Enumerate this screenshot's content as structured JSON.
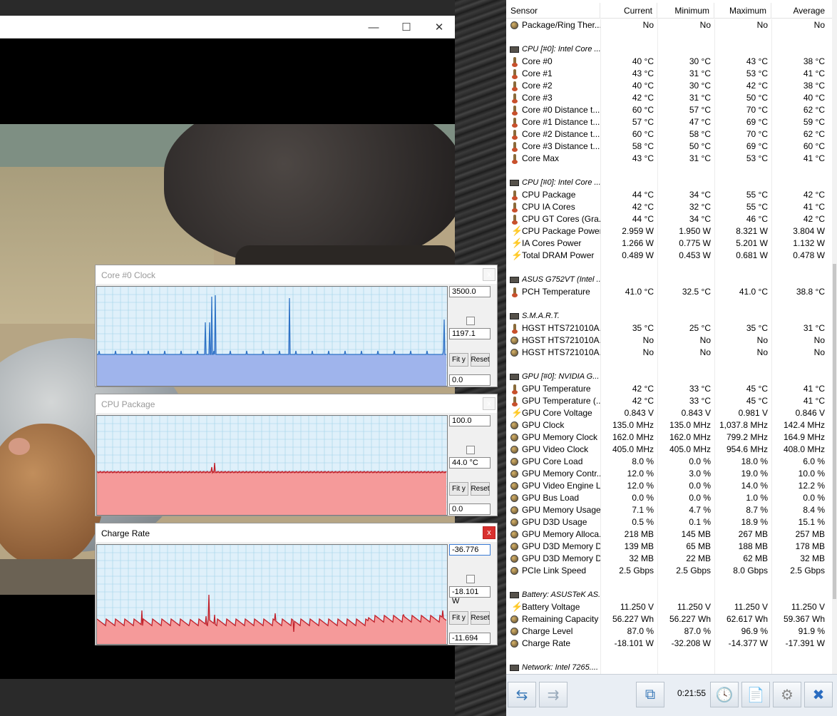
{
  "player": {
    "minimize": "—",
    "maximize": "☐",
    "close": "✕"
  },
  "graphs": [
    {
      "title": "Core #0 Clock",
      "max": "3500.0",
      "current": "1197.1",
      "min": "0.0",
      "fit": "Fit y",
      "reset": "Reset",
      "active": false,
      "fill": "#9fb4ec",
      "line": "#2f73c6",
      "close": "x",
      "data": [
        8,
        8,
        8,
        8,
        8,
        8,
        7,
        8,
        8,
        8,
        10,
        8,
        8,
        7,
        8,
        8,
        8,
        8,
        8,
        8,
        10,
        8,
        8,
        8,
        8,
        8,
        8,
        8,
        8,
        8,
        8,
        8,
        10,
        8,
        8,
        8,
        8,
        8,
        8,
        8,
        8,
        8,
        8,
        8,
        8,
        8,
        8,
        8,
        10,
        8,
        8,
        8,
        8,
        8,
        8,
        8,
        8,
        8,
        8,
        8,
        8,
        8,
        8,
        8,
        8,
        8,
        8,
        8,
        8,
        8,
        10,
        8,
        8,
        8,
        8,
        8,
        8,
        8,
        8,
        8,
        8,
        8,
        8,
        8,
        8,
        8,
        8,
        8,
        8,
        8,
        10,
        8,
        8,
        8,
        8,
        8,
        8,
        8,
        8,
        8,
        8,
        8,
        8,
        8,
        8,
        8,
        8,
        8,
        8,
        8,
        8,
        8,
        8,
        8,
        8,
        8,
        8,
        8,
        8,
        8,
        8,
        8,
        8,
        8,
        8,
        8,
        8,
        8,
        8,
        8,
        8,
        8,
        8,
        8,
        8,
        8,
        8,
        8,
        8,
        8,
        8,
        8,
        8,
        8,
        8,
        8,
        8,
        8,
        8,
        8,
        8,
        8,
        8,
        8,
        8,
        8,
        8,
        8,
        8,
        8,
        8,
        8,
        8,
        8,
        8,
        8,
        8,
        8,
        8,
        8,
        8,
        8,
        8,
        8,
        8,
        8,
        8,
        8,
        8,
        8,
        8,
        8,
        8,
        8,
        8,
        8,
        8,
        8,
        8,
        8,
        8,
        8,
        8,
        8,
        8,
        8,
        8,
        8,
        8,
        8,
        8,
        8,
        8,
        8,
        8,
        8,
        8,
        8,
        8,
        8,
        8,
        8,
        8,
        8,
        8,
        8,
        8,
        8,
        8,
        8,
        8,
        8,
        8,
        8,
        8,
        8,
        8,
        8,
        8,
        8,
        8,
        8,
        8,
        8,
        8,
        8,
        8,
        8,
        8,
        8,
        8,
        8,
        8,
        8,
        8,
        8,
        8,
        8,
        8,
        8,
        8,
        8,
        8,
        8,
        8,
        8
      ]
    },
    {
      "title": "CPU Package",
      "max": "100.0",
      "current": "44.0 °C",
      "min": "0.0",
      "fit": "Fit y",
      "reset": "Reset",
      "active": false,
      "fill": "#f59a9a",
      "line": "#c0202a",
      "close": "x",
      "data": []
    },
    {
      "title": "Charge Rate",
      "max": "-36.776",
      "current": "-18.101 W",
      "min": "-11.694",
      "fit": "Fit y",
      "reset": "Reset",
      "active": true,
      "fill": "#f59a9a",
      "line": "#c0202a",
      "close": "x",
      "data": []
    }
  ],
  "hwinfo": {
    "columns": [
      "Sensor",
      "Current",
      "Minimum",
      "Maximum",
      "Average"
    ],
    "rows": [
      {
        "t": "s",
        "i": "dot",
        "n": "Package/Ring Ther...",
        "v": [
          "No",
          "No",
          "No",
          "No"
        ]
      },
      {
        "t": "b"
      },
      {
        "t": "h",
        "i": "chip",
        "n": "CPU [#0]: Intel Core ..."
      },
      {
        "t": "s",
        "i": "therm",
        "n": "Core #0",
        "v": [
          "40 °C",
          "30 °C",
          "43 °C",
          "38 °C"
        ]
      },
      {
        "t": "s",
        "i": "therm",
        "n": "Core #1",
        "v": [
          "43 °C",
          "31 °C",
          "53 °C",
          "41 °C"
        ]
      },
      {
        "t": "s",
        "i": "therm",
        "n": "Core #2",
        "v": [
          "40 °C",
          "30 °C",
          "42 °C",
          "38 °C"
        ]
      },
      {
        "t": "s",
        "i": "therm",
        "n": "Core #3",
        "v": [
          "42 °C",
          "31 °C",
          "50 °C",
          "40 °C"
        ]
      },
      {
        "t": "s",
        "i": "therm",
        "n": "Core #0 Distance t...",
        "v": [
          "60 °C",
          "57 °C",
          "70 °C",
          "62 °C"
        ]
      },
      {
        "t": "s",
        "i": "therm",
        "n": "Core #1 Distance t...",
        "v": [
          "57 °C",
          "47 °C",
          "69 °C",
          "59 °C"
        ]
      },
      {
        "t": "s",
        "i": "therm",
        "n": "Core #2 Distance t...",
        "v": [
          "60 °C",
          "58 °C",
          "70 °C",
          "62 °C"
        ]
      },
      {
        "t": "s",
        "i": "therm",
        "n": "Core #3 Distance t...",
        "v": [
          "58 °C",
          "50 °C",
          "69 °C",
          "60 °C"
        ]
      },
      {
        "t": "s",
        "i": "therm",
        "n": "Core Max",
        "v": [
          "43 °C",
          "31 °C",
          "53 °C",
          "41 °C"
        ]
      },
      {
        "t": "b"
      },
      {
        "t": "h",
        "i": "chip",
        "n": "CPU [#0]: Intel Core ..."
      },
      {
        "t": "s",
        "i": "therm",
        "n": "CPU Package",
        "v": [
          "44 °C",
          "34 °C",
          "55 °C",
          "42 °C"
        ]
      },
      {
        "t": "s",
        "i": "therm",
        "n": "CPU IA Cores",
        "v": [
          "42 °C",
          "32 °C",
          "55 °C",
          "41 °C"
        ]
      },
      {
        "t": "s",
        "i": "therm",
        "n": "CPU GT Cores (Gra...",
        "v": [
          "44 °C",
          "34 °C",
          "46 °C",
          "42 °C"
        ]
      },
      {
        "t": "s",
        "i": "bolt",
        "n": "CPU Package Power",
        "v": [
          "2.959 W",
          "1.950 W",
          "8.321 W",
          "3.804 W"
        ]
      },
      {
        "t": "s",
        "i": "bolt",
        "n": "IA Cores Power",
        "v": [
          "1.266 W",
          "0.775 W",
          "5.201 W",
          "1.132 W"
        ]
      },
      {
        "t": "s",
        "i": "bolt",
        "n": "Total DRAM Power",
        "v": [
          "0.489 W",
          "0.453 W",
          "0.681 W",
          "0.478 W"
        ]
      },
      {
        "t": "b"
      },
      {
        "t": "h",
        "i": "chip",
        "n": "ASUS G752VT (Intel ..."
      },
      {
        "t": "s",
        "i": "therm",
        "n": "PCH Temperature",
        "v": [
          "41.0 °C",
          "32.5 °C",
          "41.0 °C",
          "38.8 °C"
        ]
      },
      {
        "t": "b"
      },
      {
        "t": "h",
        "i": "chip",
        "n": "S.M.A.R.T."
      },
      {
        "t": "s",
        "i": "therm",
        "n": "HGST HTS721010A...",
        "v": [
          "35 °C",
          "25 °C",
          "35 °C",
          "31 °C"
        ]
      },
      {
        "t": "s",
        "i": "dot",
        "n": "HGST HTS721010A...",
        "v": [
          "No",
          "No",
          "No",
          "No"
        ]
      },
      {
        "t": "s",
        "i": "dot",
        "n": "HGST HTS721010A...",
        "v": [
          "No",
          "No",
          "No",
          "No"
        ]
      },
      {
        "t": "b"
      },
      {
        "t": "h",
        "i": "chip",
        "n": "GPU [#0]: NVIDIA G..."
      },
      {
        "t": "s",
        "i": "therm",
        "n": "GPU Temperature",
        "v": [
          "42 °C",
          "33 °C",
          "45 °C",
          "41 °C"
        ]
      },
      {
        "t": "s",
        "i": "therm",
        "n": "GPU Temperature (...",
        "v": [
          "42 °C",
          "33 °C",
          "45 °C",
          "41 °C"
        ]
      },
      {
        "t": "s",
        "i": "bolt",
        "n": "GPU Core Voltage",
        "v": [
          "0.843 V",
          "0.843 V",
          "0.981 V",
          "0.846 V"
        ]
      },
      {
        "t": "s",
        "i": "dot",
        "n": "GPU Clock",
        "v": [
          "135.0 MHz",
          "135.0 MHz",
          "1,037.8 MHz",
          "142.4 MHz"
        ]
      },
      {
        "t": "s",
        "i": "dot",
        "n": "GPU Memory Clock",
        "v": [
          "162.0 MHz",
          "162.0 MHz",
          "799.2 MHz",
          "164.9 MHz"
        ]
      },
      {
        "t": "s",
        "i": "dot",
        "n": "GPU Video Clock",
        "v": [
          "405.0 MHz",
          "405.0 MHz",
          "954.6 MHz",
          "408.0 MHz"
        ]
      },
      {
        "t": "s",
        "i": "dot",
        "n": "GPU Core Load",
        "v": [
          "8.0 %",
          "0.0 %",
          "18.0 %",
          "6.0 %"
        ]
      },
      {
        "t": "s",
        "i": "dot",
        "n": "GPU Memory Contr...",
        "v": [
          "12.0 %",
          "3.0 %",
          "19.0 %",
          "10.0 %"
        ]
      },
      {
        "t": "s",
        "i": "dot",
        "n": "GPU Video Engine L...",
        "v": [
          "12.0 %",
          "0.0 %",
          "14.0 %",
          "12.2 %"
        ]
      },
      {
        "t": "s",
        "i": "dot",
        "n": "GPU Bus Load",
        "v": [
          "0.0 %",
          "0.0 %",
          "1.0 %",
          "0.0 %"
        ]
      },
      {
        "t": "s",
        "i": "dot",
        "n": "GPU Memory Usage",
        "v": [
          "7.1 %",
          "4.7 %",
          "8.7 %",
          "8.4 %"
        ]
      },
      {
        "t": "s",
        "i": "dot",
        "n": "GPU D3D Usage",
        "v": [
          "0.5 %",
          "0.1 %",
          "18.9 %",
          "15.1 %"
        ]
      },
      {
        "t": "s",
        "i": "dot",
        "n": "GPU Memory Alloca...",
        "v": [
          "218 MB",
          "145 MB",
          "267 MB",
          "257 MB"
        ]
      },
      {
        "t": "s",
        "i": "dot",
        "n": "GPU D3D Memory D...",
        "v": [
          "139 MB",
          "65 MB",
          "188 MB",
          "178 MB"
        ]
      },
      {
        "t": "s",
        "i": "dot",
        "n": "GPU D3D Memory D...",
        "v": [
          "32 MB",
          "22 MB",
          "62 MB",
          "32 MB"
        ]
      },
      {
        "t": "s",
        "i": "dot",
        "n": "PCIe Link Speed",
        "v": [
          "2.5 Gbps",
          "2.5 Gbps",
          "8.0 Gbps",
          "2.5 Gbps"
        ]
      },
      {
        "t": "b"
      },
      {
        "t": "h",
        "i": "chip",
        "n": "Battery: ASUSTeK AS..."
      },
      {
        "t": "s",
        "i": "bolt",
        "n": "Battery Voltage",
        "v": [
          "11.250 V",
          "11.250 V",
          "11.250 V",
          "11.250 V"
        ]
      },
      {
        "t": "s",
        "i": "dot",
        "n": "Remaining Capacity",
        "v": [
          "56.227 Wh",
          "56.227 Wh",
          "62.617 Wh",
          "59.367 Wh"
        ]
      },
      {
        "t": "s",
        "i": "dot",
        "n": "Charge Level",
        "v": [
          "87.0 %",
          "87.0 %",
          "96.9 %",
          "91.9 %"
        ]
      },
      {
        "t": "s",
        "i": "dot",
        "n": "Charge Rate",
        "v": [
          "-18.101 W",
          "-32.208 W",
          "-14.377 W",
          "-17.391 W"
        ]
      },
      {
        "t": "b"
      },
      {
        "t": "h",
        "i": "chip",
        "n": "Network: Intel 7265...."
      }
    ],
    "toolbar": {
      "timer": "0:21:55",
      "nav_left": "⇆",
      "nav_right": "⇉",
      "clock": "🕓",
      "report": "📄",
      "settings": "⚙",
      "exit": "✖"
    }
  }
}
